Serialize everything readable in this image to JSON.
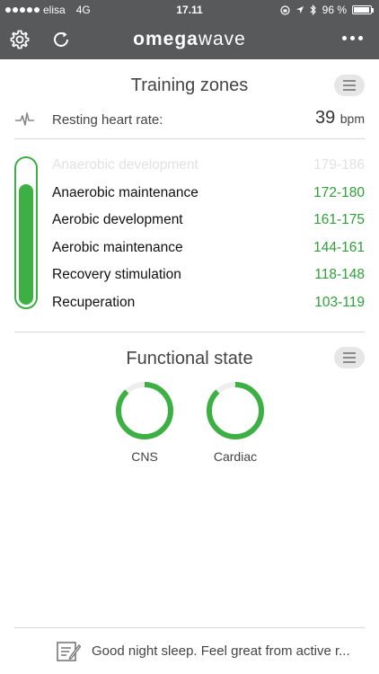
{
  "status_bar": {
    "carrier": "elisa",
    "network": "4G",
    "time": "17.11",
    "battery": "96 %",
    "battery_level": 0.96
  },
  "navbar": {
    "logo": "omegawave"
  },
  "training_zones": {
    "title": "Training zones",
    "resting_hr_label": "Resting heart rate:",
    "resting_hr_value": "39",
    "resting_hr_unit": "bpm",
    "level_fraction": 0.84,
    "zones": [
      {
        "name": "Anaerobic development",
        "range": "179-186",
        "active": false
      },
      {
        "name": "Anaerobic maintenance",
        "range": "172-180",
        "active": true
      },
      {
        "name": "Aerobic development",
        "range": "161-175",
        "active": true
      },
      {
        "name": "Aerobic maintenance",
        "range": "144-161",
        "active": true
      },
      {
        "name": "Recovery stimulation",
        "range": "118-148",
        "active": true
      },
      {
        "name": "Recuperation",
        "range": "103-119",
        "active": true
      }
    ]
  },
  "functional_state": {
    "title": "Functional state",
    "indicators": [
      {
        "label": "CNS",
        "fill_fraction": 0.88,
        "color": "#3cb043"
      },
      {
        "label": "Cardiac",
        "fill_fraction": 0.88,
        "color": "#3cb043"
      }
    ]
  },
  "footer": {
    "message": "Good night sleep. Feel great from active r..."
  }
}
